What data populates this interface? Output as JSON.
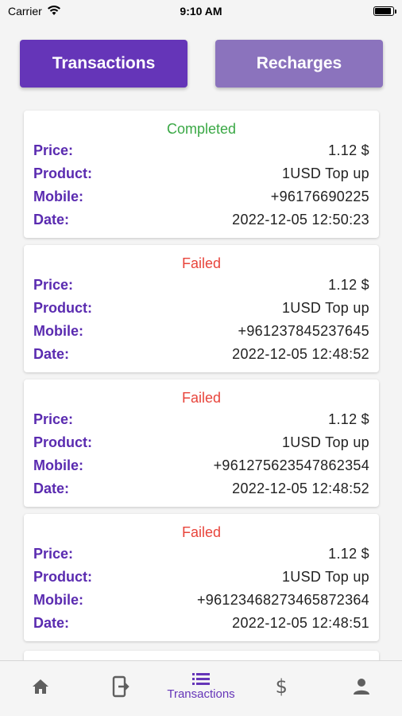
{
  "status_bar": {
    "carrier": "Carrier",
    "time": "9:10 AM"
  },
  "tabs": {
    "transactions": "Transactions",
    "recharges": "Recharges"
  },
  "labels": {
    "price": "Price:",
    "product": "Product:",
    "mobile": "Mobile:",
    "date": "Date:"
  },
  "colors": {
    "accent": "#6535b8",
    "completed": "#3aa845",
    "failed": "#e8453c"
  },
  "transactions": [
    {
      "status": "Completed",
      "status_type": "completed",
      "price": "1.12 $",
      "product": "1USD Top up",
      "mobile": "+96176690225",
      "date": "2022-12-05 12:50:23"
    },
    {
      "status": "Failed",
      "status_type": "failed",
      "price": "1.12 $",
      "product": "1USD Top up",
      "mobile": "+961237845237645",
      "date": "2022-12-05 12:48:52"
    },
    {
      "status": "Failed",
      "status_type": "failed",
      "price": "1.12 $",
      "product": "1USD Top up",
      "mobile": "+961275623547862354",
      "date": "2022-12-05 12:48:52"
    },
    {
      "status": "Failed",
      "status_type": "failed",
      "price": "1.12 $",
      "product": "1USD Top up",
      "mobile": "+9612346827346587236​4",
      "date": "2022-12-05 12:48:51"
    }
  ],
  "bottom_nav": [
    {
      "icon": "home-icon",
      "label": "",
      "active": false
    },
    {
      "icon": "exit-device-icon",
      "label": "",
      "active": false
    },
    {
      "icon": "list-icon",
      "label": "Transactions",
      "active": true
    },
    {
      "icon": "dollar-icon",
      "label": "",
      "active": false
    },
    {
      "icon": "person-icon",
      "label": "",
      "active": false
    }
  ]
}
